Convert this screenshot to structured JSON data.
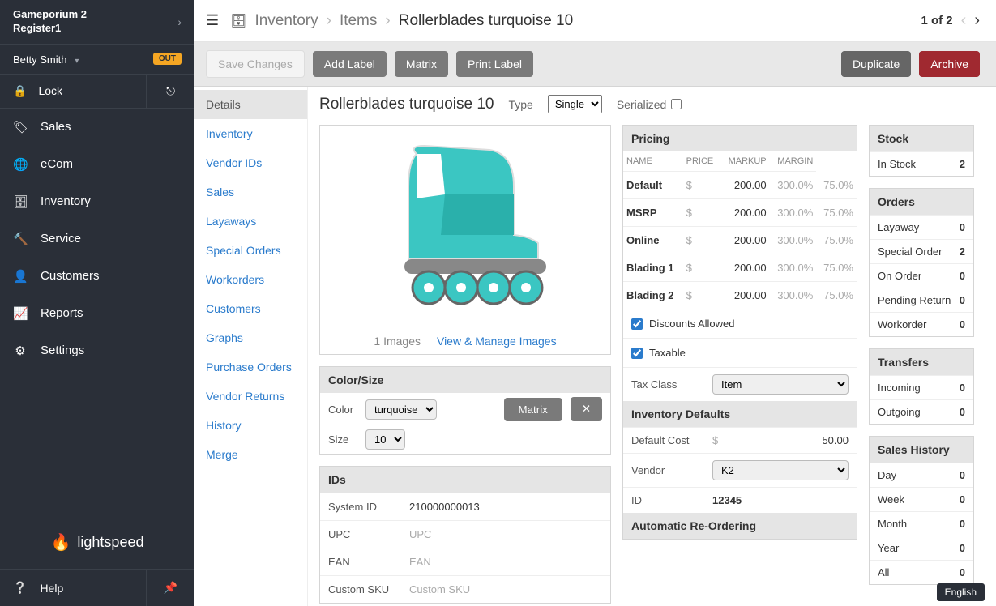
{
  "sidebar": {
    "store": "Gameporium 2",
    "register": "Register1",
    "user": "Betty Smith",
    "out": "OUT",
    "lock": "Lock",
    "nav": [
      "Sales",
      "eCom",
      "Inventory",
      "Service",
      "Customers",
      "Reports",
      "Settings"
    ],
    "logo": "lightspeed",
    "help": "Help"
  },
  "breadcrumb": {
    "l1": "Inventory",
    "l2": "Items",
    "l3": "Rollerblades turquoise 10"
  },
  "pager": {
    "label": "1 of 2"
  },
  "actions": {
    "save": "Save Changes",
    "add_label": "Add Label",
    "matrix": "Matrix",
    "print_label": "Print Label",
    "duplicate": "Duplicate",
    "archive": "Archive"
  },
  "subnav": [
    "Details",
    "Inventory",
    "Vendor IDs",
    "Sales",
    "Layaways",
    "Special Orders",
    "Workorders",
    "Customers",
    "Graphs",
    "Purchase Orders",
    "Vendor Returns",
    "History",
    "Merge"
  ],
  "item": {
    "title": "Rollerblades turquoise 10",
    "type_label": "Type",
    "type_value": "Single",
    "serialized_label": "Serialized",
    "images_count": "1 Images",
    "images_link": "View & Manage Images",
    "color_size_hdr": "Color/Size",
    "color_label": "Color",
    "color_value": "turquoise",
    "size_label": "Size",
    "size_value": "10",
    "matrix_btn": "Matrix",
    "ids_hdr": "IDs",
    "ids": {
      "system_label": "System ID",
      "system_value": "210000000013",
      "upc_label": "UPC",
      "upc_ph": "UPC",
      "ean_label": "EAN",
      "ean_ph": "EAN",
      "sku_label": "Custom SKU",
      "sku_ph": "Custom SKU"
    }
  },
  "pricing": {
    "hdr": "Pricing",
    "cols": {
      "name": "NAME",
      "price": "PRICE",
      "markup": "MARKUP",
      "margin": "MARGIN"
    },
    "rows": [
      {
        "name": "Default",
        "price": "200.00",
        "markup": "300.0%",
        "margin": "75.0%"
      },
      {
        "name": "MSRP",
        "price": "200.00",
        "markup": "300.0%",
        "margin": "75.0%"
      },
      {
        "name": "Online",
        "price": "200.00",
        "markup": "300.0%",
        "margin": "75.0%"
      },
      {
        "name": "Blading 1",
        "price": "200.00",
        "markup": "300.0%",
        "margin": "75.0%"
      },
      {
        "name": "Blading 2",
        "price": "200.00",
        "markup": "300.0%",
        "margin": "75.0%"
      }
    ],
    "discounts_label": "Discounts Allowed",
    "taxable_label": "Taxable",
    "tax_class_label": "Tax Class",
    "tax_class_value": "Item",
    "inventory_defaults_hdr": "Inventory Defaults",
    "default_cost_label": "Default Cost",
    "default_cost_value": "50.00",
    "vendor_label": "Vendor",
    "vendor_value": "K2",
    "id_label": "ID",
    "id_value": "12345",
    "auto_reorder_hdr": "Automatic Re-Ordering"
  },
  "side": {
    "stock_hdr": "Stock",
    "in_stock_label": "In Stock",
    "in_stock_val": "2",
    "orders_hdr": "Orders",
    "orders": [
      {
        "k": "Layaway",
        "v": "0"
      },
      {
        "k": "Special Order",
        "v": "2"
      },
      {
        "k": "On Order",
        "v": "0"
      },
      {
        "k": "Pending Return",
        "v": "0"
      },
      {
        "k": "Workorder",
        "v": "0"
      }
    ],
    "transfers_hdr": "Transfers",
    "transfers": [
      {
        "k": "Incoming",
        "v": "0"
      },
      {
        "k": "Outgoing",
        "v": "0"
      }
    ],
    "sales_hdr": "Sales History",
    "sales": [
      {
        "k": "Day",
        "v": "0"
      },
      {
        "k": "Week",
        "v": "0"
      },
      {
        "k": "Month",
        "v": "0"
      },
      {
        "k": "Year",
        "v": "0"
      },
      {
        "k": "All",
        "v": "0"
      }
    ]
  },
  "lang": "English"
}
